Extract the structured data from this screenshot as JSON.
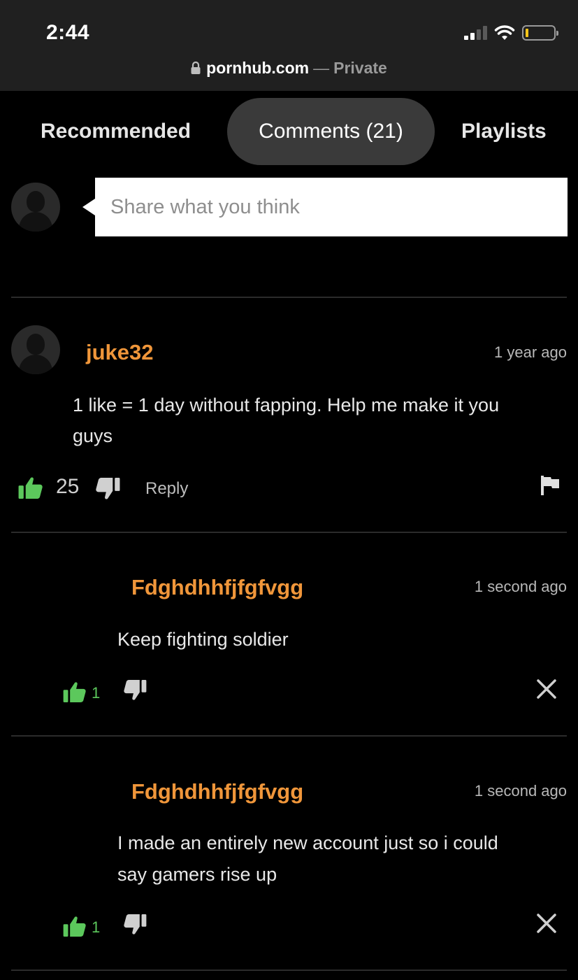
{
  "status_bar": {
    "time": "2:44"
  },
  "url_bar": {
    "domain": "pornhub.com",
    "separator": "—",
    "mode": "Private"
  },
  "tabs": [
    {
      "label": "Recommended",
      "active": false
    },
    {
      "label": "Comments (21)",
      "active": true
    },
    {
      "label": "Playlists",
      "active": false
    }
  ],
  "comment_input": {
    "placeholder": "Share what you think"
  },
  "comments": [
    {
      "username": "juke32",
      "timestamp": "1 year ago",
      "text_lines": [
        "1 like = 1 day without fapping. Help me make it you",
        "guys"
      ],
      "likes": "25",
      "reply_label": "Reply"
    }
  ],
  "replies": [
    {
      "username": "Fdghdhhfjfgfvgg",
      "timestamp": "1 second ago",
      "text_lines": [
        "Keep fighting soldier"
      ],
      "likes": "1"
    },
    {
      "username": "Fdghdhhfjfgfvgg",
      "timestamp": "1 second ago",
      "text_lines": [
        "I made an entirely new account just so i could",
        "say gamers rise up"
      ],
      "likes": "1"
    }
  ],
  "colors": {
    "background": "#000000",
    "topbar": "#202020",
    "username": "#f0963a",
    "like_green": "#5cc85c",
    "active_tab": "#3a3a3a"
  }
}
